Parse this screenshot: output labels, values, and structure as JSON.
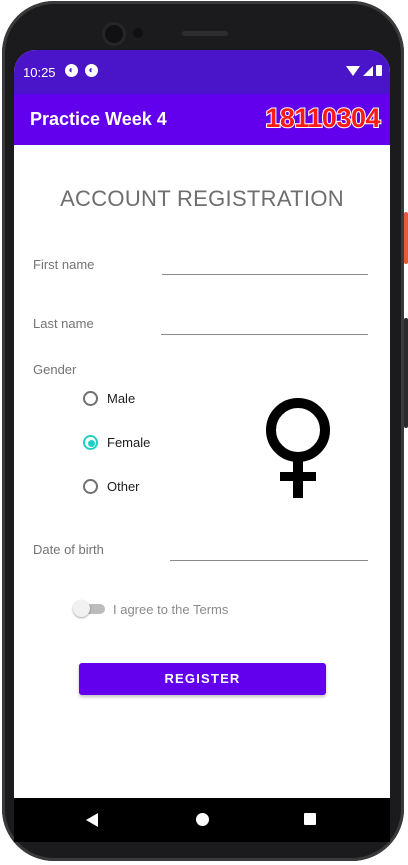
{
  "status_bar": {
    "time": "10:25",
    "notification_icons": [
      "app-notification-icon",
      "app-notification-icon"
    ]
  },
  "app_bar": {
    "title": "Practice Week 4",
    "student_id": "18110304"
  },
  "form": {
    "heading": "ACCOUNT REGISTRATION",
    "first_name": {
      "label": "First name",
      "value": ""
    },
    "last_name": {
      "label": "Last name",
      "value": ""
    },
    "gender": {
      "label": "Gender",
      "options": [
        "Male",
        "Female",
        "Other"
      ],
      "selected": "Female",
      "symbol_icon": "venus-female-symbol-icon"
    },
    "date_of_birth": {
      "label": "Date of birth",
      "value": ""
    },
    "terms": {
      "label": "I agree to the Terms",
      "checked": false
    },
    "register_label": "REGISTER"
  },
  "colors": {
    "status_bar": "#4a14c8",
    "app_bar": "#6200ee",
    "accent_radio": "#1fd1c1",
    "student_id": "#ff1a1a",
    "button": "#6200ee"
  },
  "nav": {
    "buttons": [
      "back-icon",
      "home-icon",
      "recent-apps-icon"
    ]
  }
}
